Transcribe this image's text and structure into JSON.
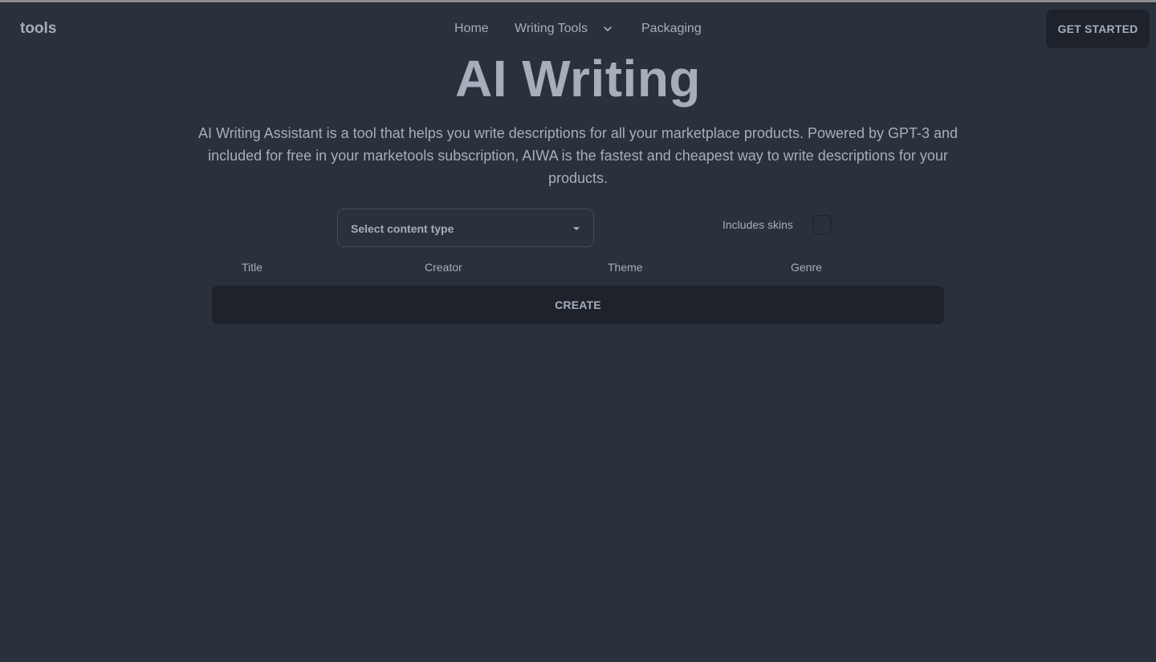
{
  "header": {
    "brand": "tools",
    "nav": {
      "home": "Home",
      "writing_tools": "Writing Tools",
      "packaging": "Packaging"
    },
    "cta_label": "GET STARTED"
  },
  "hero": {
    "title": "AI Writing",
    "description": "AI Writing Assistant is a tool that helps you write descriptions for all your marketplace products. Powered by GPT-3 and included for free in your marketools subscription, AIWA is the fastest and cheapest way to write descriptions for your products."
  },
  "form": {
    "content_type_select": "Select content type",
    "skins_label": "Includes skins",
    "skins_checked": false,
    "fields": {
      "title": "Title",
      "creator": "Creator",
      "theme": "Theme",
      "genre": "Genre"
    },
    "create_label": "CREATE"
  },
  "icons": {
    "nav_dropdown": "chevron-down-icon",
    "select_dropdown": "caret-down-icon"
  },
  "colors": {
    "background": "#2a303c",
    "text": "#a6adbb",
    "button": "#1d222b"
  }
}
